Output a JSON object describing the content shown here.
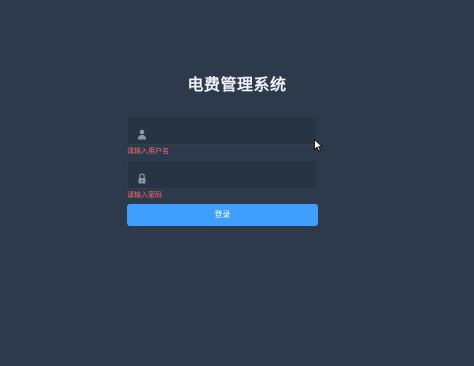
{
  "app": {
    "title": "电费管理系统"
  },
  "login_form": {
    "username": {
      "value": "",
      "placeholder": "",
      "icon": "user-icon",
      "error": "请输入用户名"
    },
    "password": {
      "value": "",
      "placeholder": "",
      "icon": "lock-icon",
      "error": "请输入密码"
    },
    "login_label": "登录"
  },
  "colors": {
    "background": "#2d3a4b",
    "input_background": "#283443",
    "error": "#f56c6c",
    "button": "#409eff",
    "title": "#eef1f5"
  }
}
